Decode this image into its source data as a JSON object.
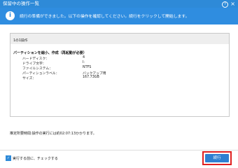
{
  "window": {
    "title": "保留中の操作一覧",
    "help_label": "?",
    "close_label": "×"
  },
  "banner": {
    "message": "続行の準備ができました。以下の操作を確認してください。続行をクリックして開始します。"
  },
  "operations": {
    "group_title": "1の1操作",
    "operation_title": "パーティションを縮小、作成（再起動が必要）",
    "details": [
      {
        "label": "ハードディスク：",
        "value": "4"
      },
      {
        "label": "ドライブ文字：",
        "value": "I:"
      },
      {
        "label": "ファイルシステム：",
        "value": "NTFS"
      },
      {
        "label": "パーティションラベル：",
        "value": "バックアップ用"
      },
      {
        "label": "サイズ：",
        "value": "167.73GB"
      }
    ]
  },
  "estimate_text": "推定所要時間:操作の実行には約02:07:13かかります。",
  "footer": {
    "checkbox_label": "実行する前に、チェックする",
    "checkbox_checked": true,
    "run_button_label": "続行"
  },
  "colors": {
    "accent": "#2e8ad8",
    "highlight": "#e02020"
  }
}
